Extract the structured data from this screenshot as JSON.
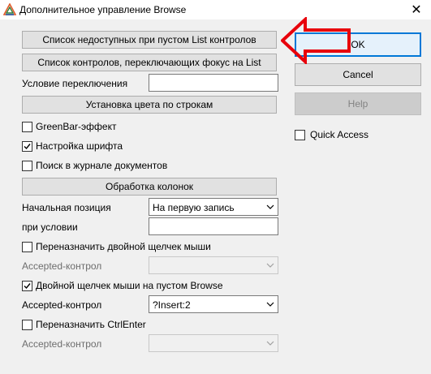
{
  "window": {
    "title": "Дополнительное управление Browse",
    "close_glyph": "✕"
  },
  "left": {
    "btn_unavailable_list": "Список недоступных при пустом List контролов",
    "btn_focus_controls": "Список контролов, переключающих фокус на List",
    "switch_condition_label": "Условие переключения",
    "switch_condition_value": "",
    "btn_row_color": "Установка цвета по строкам",
    "greenbar_label": "GreenBar-эффект",
    "greenbar_checked": false,
    "font_setup_label": "Настройка шрифта",
    "font_setup_checked": true,
    "doc_journal_label": "Поиск в журнале документов",
    "doc_journal_checked": false,
    "btn_column_processing": "Обработка колонок",
    "start_position_label": "Начальная позиция",
    "start_position_value": "На первую запись",
    "condition_label": "при условии",
    "condition_value": "",
    "reassign_dblclick_label": "Переназначить двойной щелчек мыши",
    "reassign_dblclick_checked": false,
    "accepted_control_1_label": "Accepted-контрол",
    "accepted_control_1_value": "",
    "dblclick_empty_label": "Двойной щелчек мыши на пустом Browse",
    "dblclick_empty_checked": true,
    "accepted_control_2_label": "Accepted-контрол",
    "accepted_control_2_value": "?Insert:2",
    "reassign_ctrlenter_label": "Переназначить CtrlEnter",
    "reassign_ctrlenter_checked": false,
    "accepted_control_3_label": "Accepted-контрол",
    "accepted_control_3_value": ""
  },
  "right": {
    "ok_label": "OK",
    "cancel_label": "Cancel",
    "help_label": "Help",
    "quick_access_label": "Quick Access",
    "quick_access_checked": false
  },
  "colors": {
    "annotation_arrow": "#e8000b",
    "default_button_border": "#0078d7"
  }
}
